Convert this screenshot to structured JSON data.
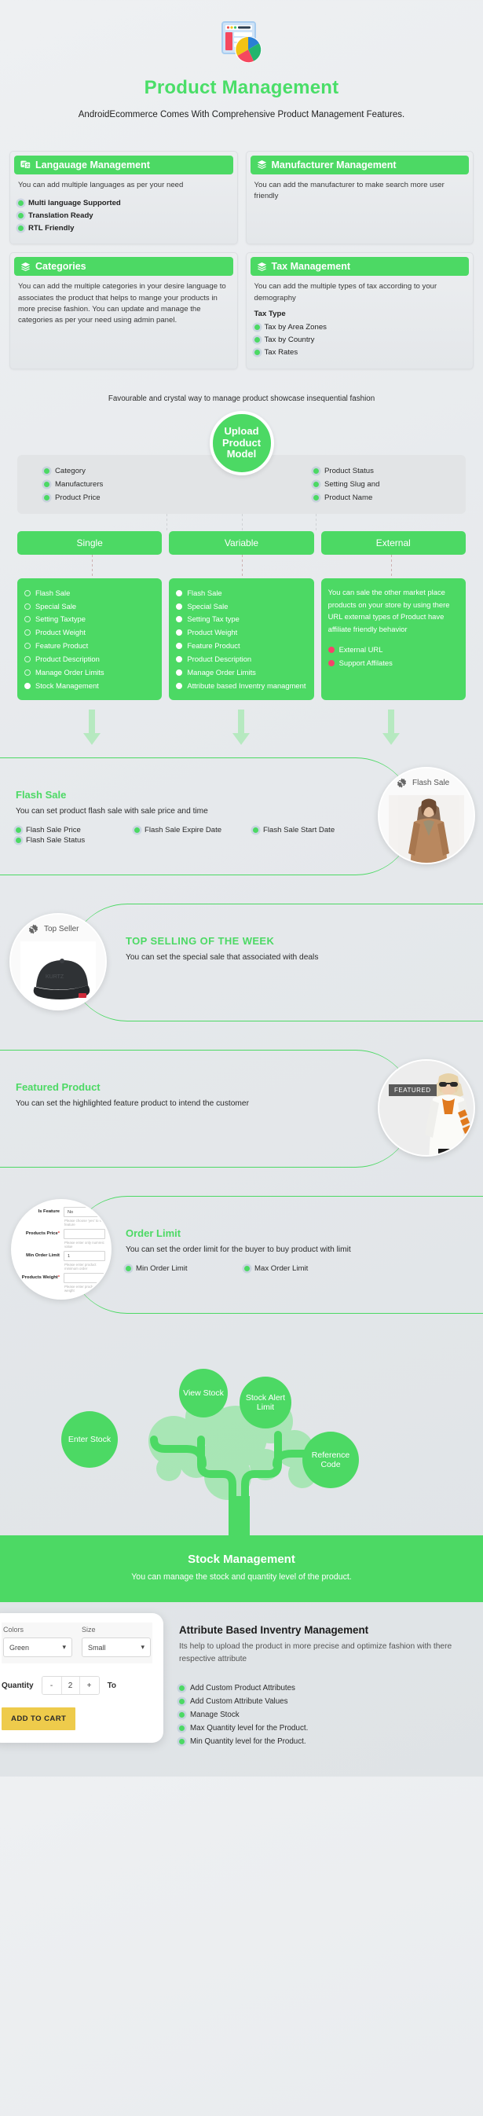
{
  "hero": {
    "title": "Product Management",
    "subtitle": "AndroidEcommerce Comes With Comprehensive Product Management Features.",
    "icon": "product-dashboard-pie-icon"
  },
  "accent": "#4cd964",
  "cards": [
    {
      "icon": "translate-icon",
      "title": "Langauage Management",
      "desc": "You can add multiple languages as per your need",
      "bullets": [
        "Multi language Supported",
        "Translation Ready",
        "RTL Friendly"
      ],
      "bold_bullets": true
    },
    {
      "icon": "layers-icon",
      "title": "Manufacturer Management",
      "desc": "You can add the manufacturer to make search more user friendly",
      "bullets": []
    },
    {
      "icon": "layers-icon",
      "title": "Categories",
      "desc": "You can add the multiple categories in your desire language to associates the product that helps to mange your products in more precise fashion. You can update and manage the categories as per your need using admin panel.",
      "bullets": []
    },
    {
      "icon": "layers-icon",
      "title": "Tax Management",
      "desc": "You can add the multiple types of tax according to your demography",
      "sublabel": "Tax Type",
      "bullets": [
        "Tax by Area Zones",
        "Tax by Country",
        "Tax Rates"
      ]
    }
  ],
  "tagline": "Favourable and crystal way to manage product showcase insequential fashion",
  "model": {
    "center": "Upload Product Model",
    "left": [
      "Category",
      "Manufacturers",
      "Product Price"
    ],
    "right": [
      "Product Status",
      "Setting Slug and",
      "Product Name"
    ]
  },
  "types": [
    {
      "name": "Single",
      "items": [
        {
          "label": "Flash Sale",
          "filled": false
        },
        {
          "label": "Special Sale",
          "filled": false
        },
        {
          "label": "Setting Taxtype",
          "filled": false
        },
        {
          "label": "Product Weight",
          "filled": false
        },
        {
          "label": "Feature Product",
          "filled": false
        },
        {
          "label": "Product Description",
          "filled": false
        },
        {
          "label": "Manage Order Limits",
          "filled": false
        },
        {
          "label": "Stock Management",
          "filled": true
        }
      ]
    },
    {
      "name": "Variable",
      "items": [
        {
          "label": "Flash Sale",
          "filled": true
        },
        {
          "label": "Special Sale",
          "filled": true
        },
        {
          "label": "Setting Tax type",
          "filled": true
        },
        {
          "label": "Product Weight",
          "filled": true
        },
        {
          "label": "Feature Product",
          "filled": true
        },
        {
          "label": "Product Description",
          "filled": true
        },
        {
          "label": "Manage Order Limits",
          "filled": true
        },
        {
          "label": "Attribute based Inventry managment",
          "filled": true
        }
      ]
    },
    {
      "name": "External",
      "text": "You can sale the other market place products on your store by using there URL external types of Product have  affiliate friendly behavior",
      "items": [
        {
          "label": "External URL",
          "pink": true
        },
        {
          "label": "Support Affilates",
          "pink": true
        }
      ]
    }
  ],
  "features": [
    {
      "id": "flash-sale",
      "title": "Flash Sale",
      "desc": "You can set product flash sale with sale price and time",
      "bullets": [
        "Flash Sale Price",
        "Flash Sale Expire Date",
        "Flash Sale Start Date",
        "Flash Sale Status"
      ],
      "photo_chip": "Flash Sale",
      "photo_side": "right"
    },
    {
      "id": "top-seller",
      "title": "TOP SELLING OF THE WEEK",
      "desc": "You can set the special sale that associated with deals",
      "bullets": [],
      "photo_chip": "Top Seller",
      "photo_side": "left"
    },
    {
      "id": "featured-product",
      "title": "Featured Product",
      "desc": "You can set the highlighted feature product to intend the customer",
      "bullets": [],
      "photo_badge": "FEATURED",
      "photo_side": "right"
    },
    {
      "id": "order-limit",
      "title": "Order Limit",
      "desc": "You can set the order limit for the buyer to buy product with limit",
      "bullets": [
        "Min Order Limit",
        "Max Order Limit"
      ],
      "photo_side": "left-form"
    }
  ],
  "form_preview": {
    "rows": [
      {
        "label": "Is Feature",
        "value": "No",
        "required": false,
        "hint": "Please choose 'yes' to set feature"
      },
      {
        "label": "Products Price",
        "value": "",
        "required": true,
        "hint": "Please enter only numreic value"
      },
      {
        "label": "Min Order Limit",
        "value": "1",
        "required": false,
        "hint": "Please enter product minimum order"
      },
      {
        "label": "Products Weight",
        "value": "",
        "required": true,
        "hint": "Please enter product weight"
      }
    ]
  },
  "tree": {
    "nodes": [
      "View Stock",
      "Stock Alert Limit",
      "Enter Stock",
      "Reference Code"
    ],
    "band_title": "Stock Management",
    "band_desc": "You can manage the stock and quantity level of the product."
  },
  "attribute": {
    "title": "Attribute Based Inventry Management",
    "desc": "Its help to upload the product in more precise and optimize fashion with there respective attribute",
    "bullets": [
      "Add Custom Product Attributes",
      "Add Custom Attribute Values",
      "Manage Stock",
      "Max Quantity level for the Product.",
      "Min Quantity level for the Product."
    ],
    "widget": {
      "colors_label": "Colors",
      "colors_value": "Green",
      "size_label": "Size",
      "size_value": "Small",
      "quantity_label": "Quantity",
      "quantity_value": "2",
      "minus": "-",
      "plus": "+",
      "total_label": "To",
      "cart_button": "ADD TO CART"
    }
  }
}
